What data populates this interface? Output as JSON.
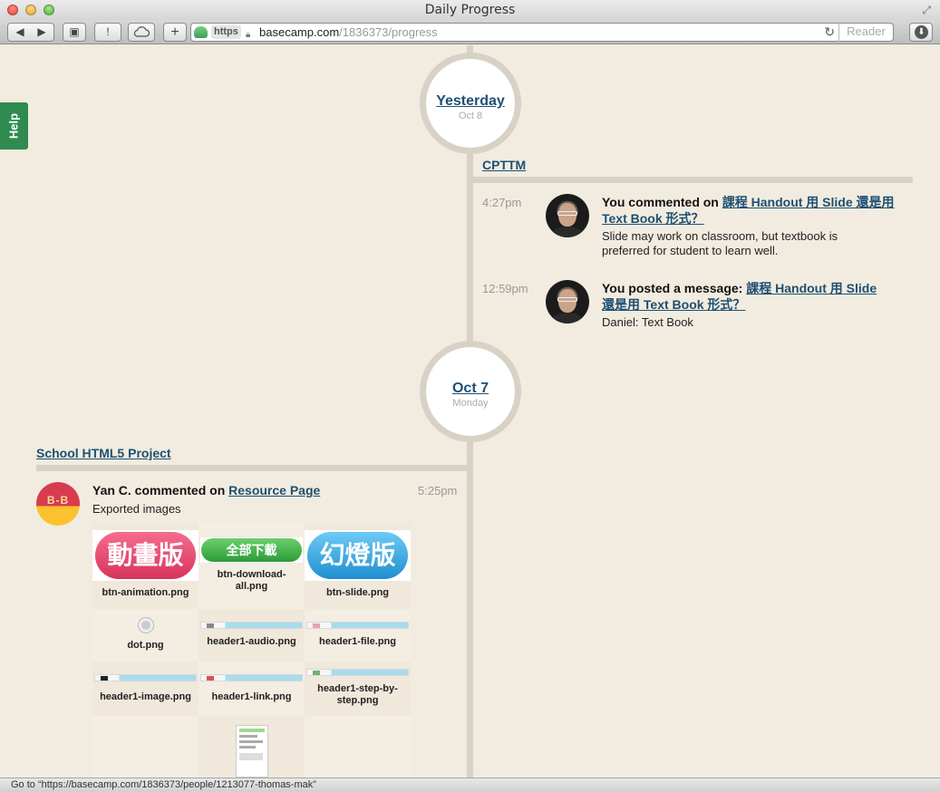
{
  "window": {
    "title": "Daily Progress"
  },
  "toolbar": {
    "back_glyph": "◀",
    "forward_glyph": "▶",
    "alert_glyph": "!",
    "add_glyph": "+",
    "https_label": "https",
    "url_host": "basecamp.com",
    "url_path": "/1836373/progress",
    "reader_label": "Reader"
  },
  "help": {
    "label": "Help"
  },
  "days": [
    {
      "title": "Yesterday",
      "subtitle": "Oct 8",
      "project": "CPTTM",
      "entries": [
        {
          "time": "4:27pm",
          "action": "You commented on ",
          "link": "課程 Handout 用 Slide 還是用 Text Book 形式？",
          "body": "Slide may work on classroom, but textbook is preferred for student to learn well."
        },
        {
          "time": "12:59pm",
          "action": "You posted a message: ",
          "link": "課程 Handout 用 Slide 還是用 Text Book 形式？",
          "body": "Daniel: Text Book"
        }
      ]
    },
    {
      "title": "Oct 7",
      "subtitle": "Monday",
      "project": "School HTML5 Project",
      "entries": [
        {
          "time": "5:25pm",
          "action": "Yan C. commented on ",
          "link": "Resource Page",
          "body": "Exported images",
          "avatar_text": "B-B"
        }
      ]
    }
  ],
  "attachments": [
    {
      "name": "btn-animation.png",
      "thumb_text": "動畫版"
    },
    {
      "name": "btn-download-all.png",
      "thumb_text": "全部下載"
    },
    {
      "name": "btn-slide.png",
      "thumb_text": "幻燈版"
    },
    {
      "name": "dot.png"
    },
    {
      "name": "header1-audio.png"
    },
    {
      "name": "header1-file.png"
    },
    {
      "name": "header1-image.png"
    },
    {
      "name": "header1-link.png"
    },
    {
      "name": "header1-step-by-step.png"
    }
  ],
  "statusbar": {
    "text": "Go to “https://basecamp.com/1836373/people/1213077-thomas-mak”"
  }
}
